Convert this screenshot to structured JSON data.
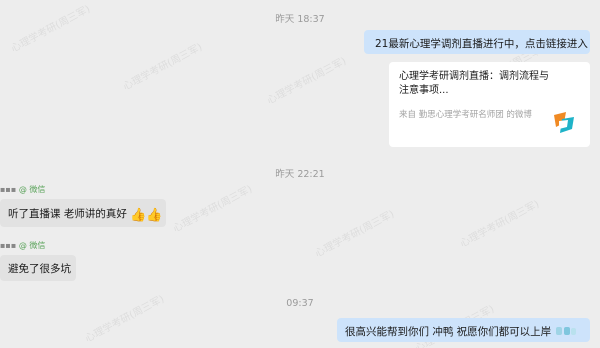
{
  "watermark": "心理学考研(周三军)",
  "messages": {
    "t1": "昨天 18:37",
    "out1": "21最新心理学调剂直播进行中，点击链接进入",
    "card": {
      "title": "心理学考研调剂直播：调剂流程与注意事项...",
      "source": "来自 勤思心理学考研名师团 的微博"
    },
    "t2": "昨天 22:21",
    "sender1": {
      "name": "▪▪▪",
      "channel": "@ 微信"
    },
    "in1": "听了直播课 老师讲的真好",
    "in1_emoji": "👍👍",
    "sender2": {
      "name": "▪▪▪",
      "channel": "@ 微信"
    },
    "in2": "避免了很多坑",
    "t3": "09:37",
    "out2": "很高兴能帮到你们 冲鸭 祝愿你们都可以上岸"
  },
  "colors": {
    "background": "#ededed",
    "outgoing_bubble": "#cde3fb",
    "incoming_bubble": "#e2e2e2",
    "logo_orange": "#f08a24",
    "logo_teal": "#1fb3c8",
    "wechat_green": "#5aa35a"
  },
  "icons": [
    "thumbs-up-icon",
    "weibo-logo-icon",
    "hand-emoji-icon"
  ]
}
